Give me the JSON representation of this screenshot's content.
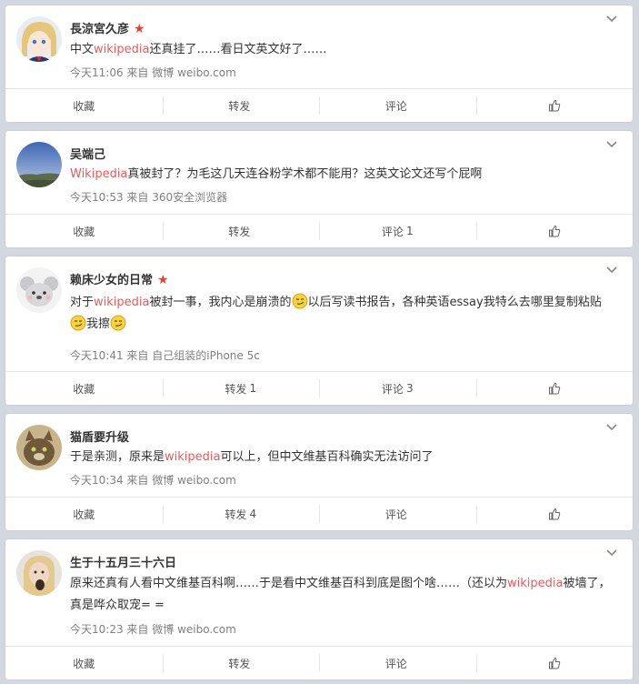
{
  "actions": {
    "collect": "收藏",
    "repost": "转发",
    "comment": "评论"
  },
  "posts": [
    {
      "username": "長涼宮久彦",
      "verified": true,
      "text": [
        "中文",
        "wikipedia",
        "还真挂了……看日文英文好了……"
      ],
      "time": "今天11:06",
      "source_prefix": "来自",
      "source": "微博 weibo.com",
      "repost_count": "",
      "comment_count": ""
    },
    {
      "username": "吴端己",
      "verified": false,
      "text": [
        "Wikipedia",
        "真被封了？为毛这几天连谷粉学术都不能用？这英文论文还写个屁啊"
      ],
      "time": "今天10:53",
      "source_prefix": "来自",
      "source": "360安全浏览器",
      "repost_count": "",
      "comment_count": "1"
    },
    {
      "username": "赖床少女的日常",
      "verified": true,
      "text": [
        "对于",
        "wikipedia",
        "被封一事，我内心是崩溃的",
        "以后写读书报告，各种英语essay我特么去哪里复制粘贴",
        "我擦"
      ],
      "time": "今天10:41",
      "source_prefix": "来自",
      "source": "自己组装的iPhone 5c",
      "repost_count": "1",
      "comment_count": "3"
    },
    {
      "username": "猫盾要升级",
      "verified": false,
      "text": [
        "于是亲测，原来是",
        "wikipedia",
        "可以上，但中文维基百科确实无法访问了"
      ],
      "time": "今天10:34",
      "source_prefix": "来自",
      "source": "微博 weibo.com",
      "repost_count": "4",
      "comment_count": ""
    },
    {
      "username": "生于十五月三十六日",
      "verified": false,
      "text": [
        "原来还真有人看中文维基百科啊……于是看中文维基百科到底是图个啥……（还以为",
        "wikipedia",
        "被墙了，真是哗众取宠= ="
      ],
      "time": "今天10:23",
      "source_prefix": "来自",
      "source": "微博 weibo.com",
      "repost_count": "",
      "comment_count": ""
    }
  ],
  "colors": {
    "highlight": "#eb5a5a",
    "meta": "#808080",
    "background": "#d3d8e0",
    "vip_star": "#e8402a"
  },
  "icons": {
    "more": "chevron-down-icon",
    "like": "thumbs-up-icon",
    "vip": "star-icon",
    "emoji": "smirk-face-icon"
  }
}
